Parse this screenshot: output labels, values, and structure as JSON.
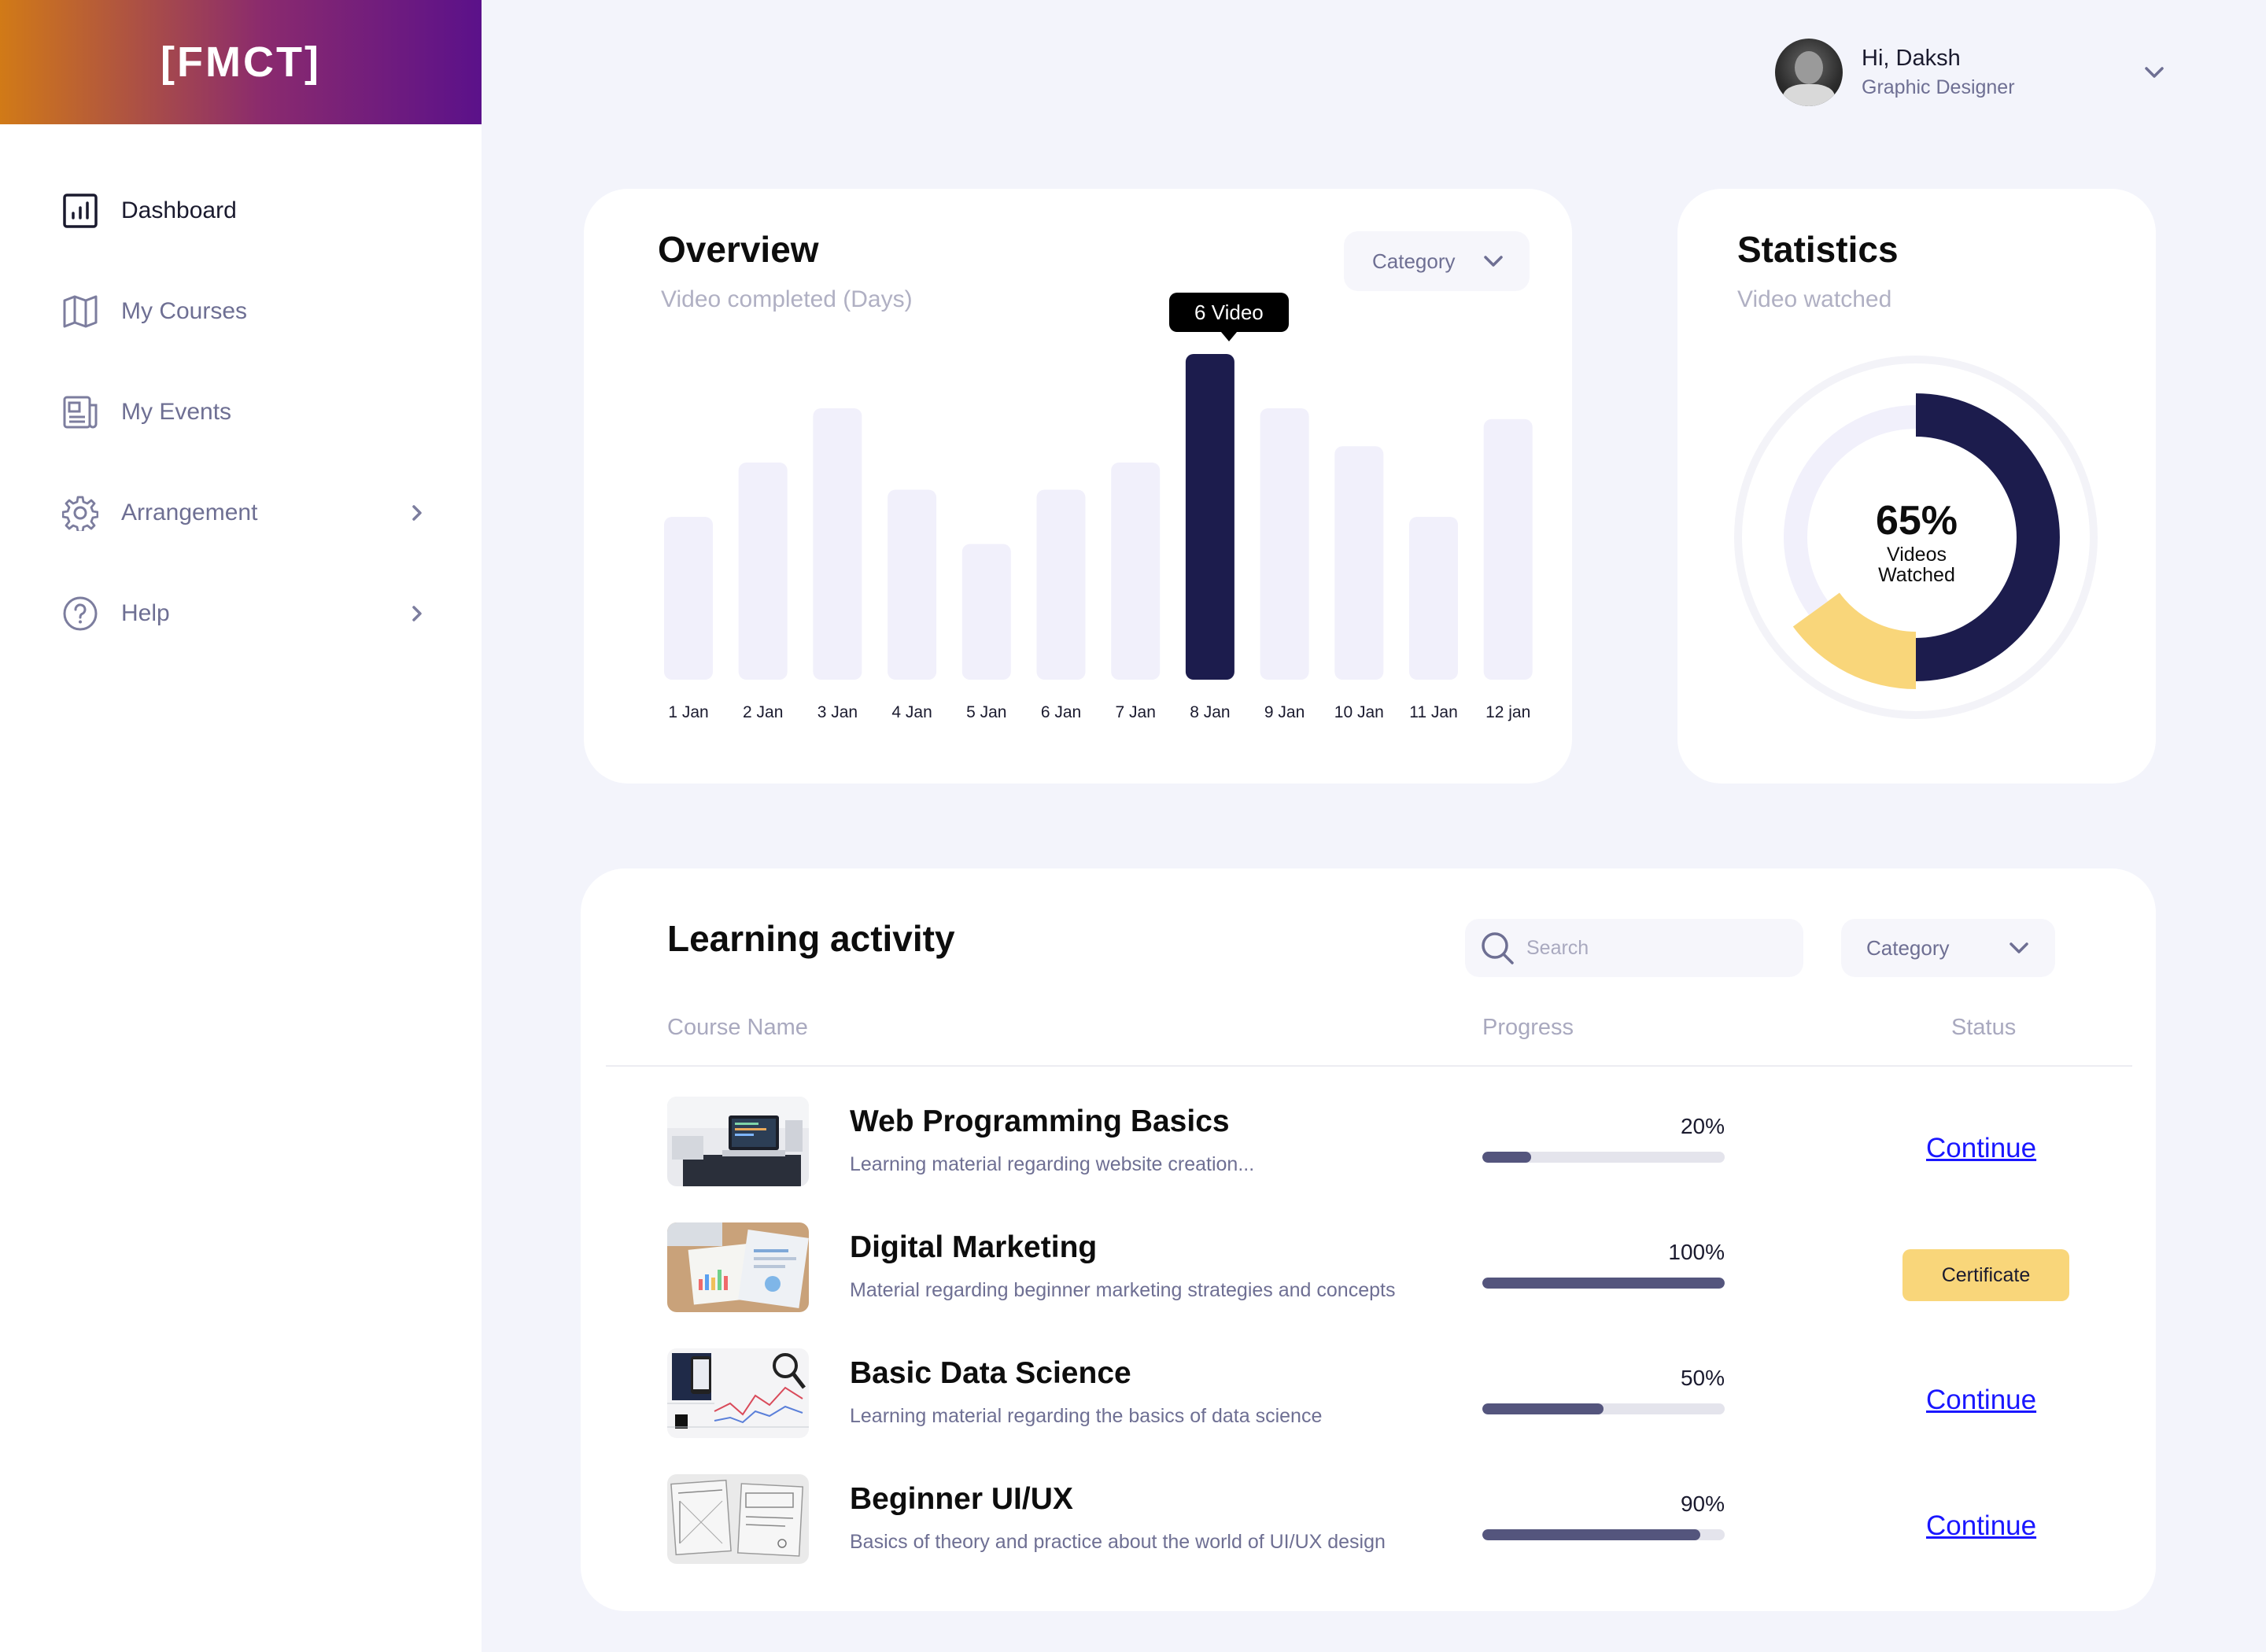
{
  "brand": {
    "logo_text": "[FMCT]"
  },
  "sidebar": {
    "items": [
      {
        "label": "Dashboard",
        "icon": "chart-icon",
        "active": true
      },
      {
        "label": "My Courses",
        "icon": "map-icon",
        "active": false
      },
      {
        "label": "My Events",
        "icon": "newspaper-icon",
        "active": false
      },
      {
        "label": "Arrangement",
        "icon": "gear-icon",
        "active": false,
        "has_submenu": true
      },
      {
        "label": "Help",
        "icon": "help-icon",
        "active": false,
        "has_submenu": true
      }
    ]
  },
  "user": {
    "greeting": "Hi, Daksh",
    "role": "Graphic Designer"
  },
  "overview": {
    "title": "Overview",
    "subtitle": "Video completed (Days)",
    "filter_label": "Category",
    "tooltip": "6 Video",
    "chart_data": {
      "type": "bar",
      "categories": [
        "1 Jan",
        "2 Jan",
        "3 Jan",
        "4 Jan",
        "5 Jan",
        "6 Jan",
        "7 Jan",
        "8 Jan",
        "9 Jan",
        "10 Jan",
        "11 Jan",
        "12 jan"
      ],
      "values": [
        3,
        4,
        5,
        3.5,
        2.5,
        3.5,
        4,
        6,
        5,
        4.3,
        3,
        4.8
      ],
      "highlighted_index": 7,
      "ylim": [
        0,
        6
      ],
      "grid": false,
      "colors": {
        "bar": "#f1f0fb",
        "highlight": "#1c1c4d"
      }
    }
  },
  "statistics": {
    "title": "Statistics",
    "subtitle": "Video watched",
    "percent_text": "65%",
    "center_label_line1": "Videos",
    "center_label_line2": "Watched",
    "chart_data": {
      "type": "pie",
      "segments": [
        {
          "value": 50,
          "color": "#1c1c4d"
        },
        {
          "value": 15,
          "color": "#f9d67a"
        },
        {
          "value": 35,
          "color": "#f1f0fb"
        }
      ]
    }
  },
  "learning": {
    "title": "Learning activity",
    "search_placeholder": "Search",
    "filter_label": "Category",
    "columns": {
      "course": "Course Name",
      "progress": "Progress",
      "status": "Status"
    },
    "rows": [
      {
        "title": "Web Programming Basics",
        "desc": "Learning material regarding website creation...",
        "progress": 20,
        "progress_text": "20%",
        "status": "Continue",
        "status_type": "link",
        "thumb": "laptop-thumbnail"
      },
      {
        "title": "Digital Marketing",
        "desc": "Material regarding beginner marketing strategies and concepts",
        "progress": 100,
        "progress_text": "100%",
        "status": "Certificate",
        "status_type": "button",
        "thumb": "charts-paper-thumbnail"
      },
      {
        "title": "Basic Data Science",
        "desc": "Learning material regarding the basics of data science",
        "progress": 50,
        "progress_text": "50%",
        "status": "Continue",
        "status_type": "link",
        "thumb": "phone-graph-thumbnail"
      },
      {
        "title": "Beginner UI/UX",
        "desc": "Basics of theory and practice about the world of UI/UX design",
        "progress": 90,
        "progress_text": "90%",
        "status": "Continue",
        "status_type": "link",
        "thumb": "wireframe-thumbnail"
      }
    ]
  },
  "colors": {
    "accent_dark": "#1c1c4d",
    "accent_yellow": "#f9d67a",
    "link": "#1a17ff",
    "muted": "#6e6f93"
  }
}
